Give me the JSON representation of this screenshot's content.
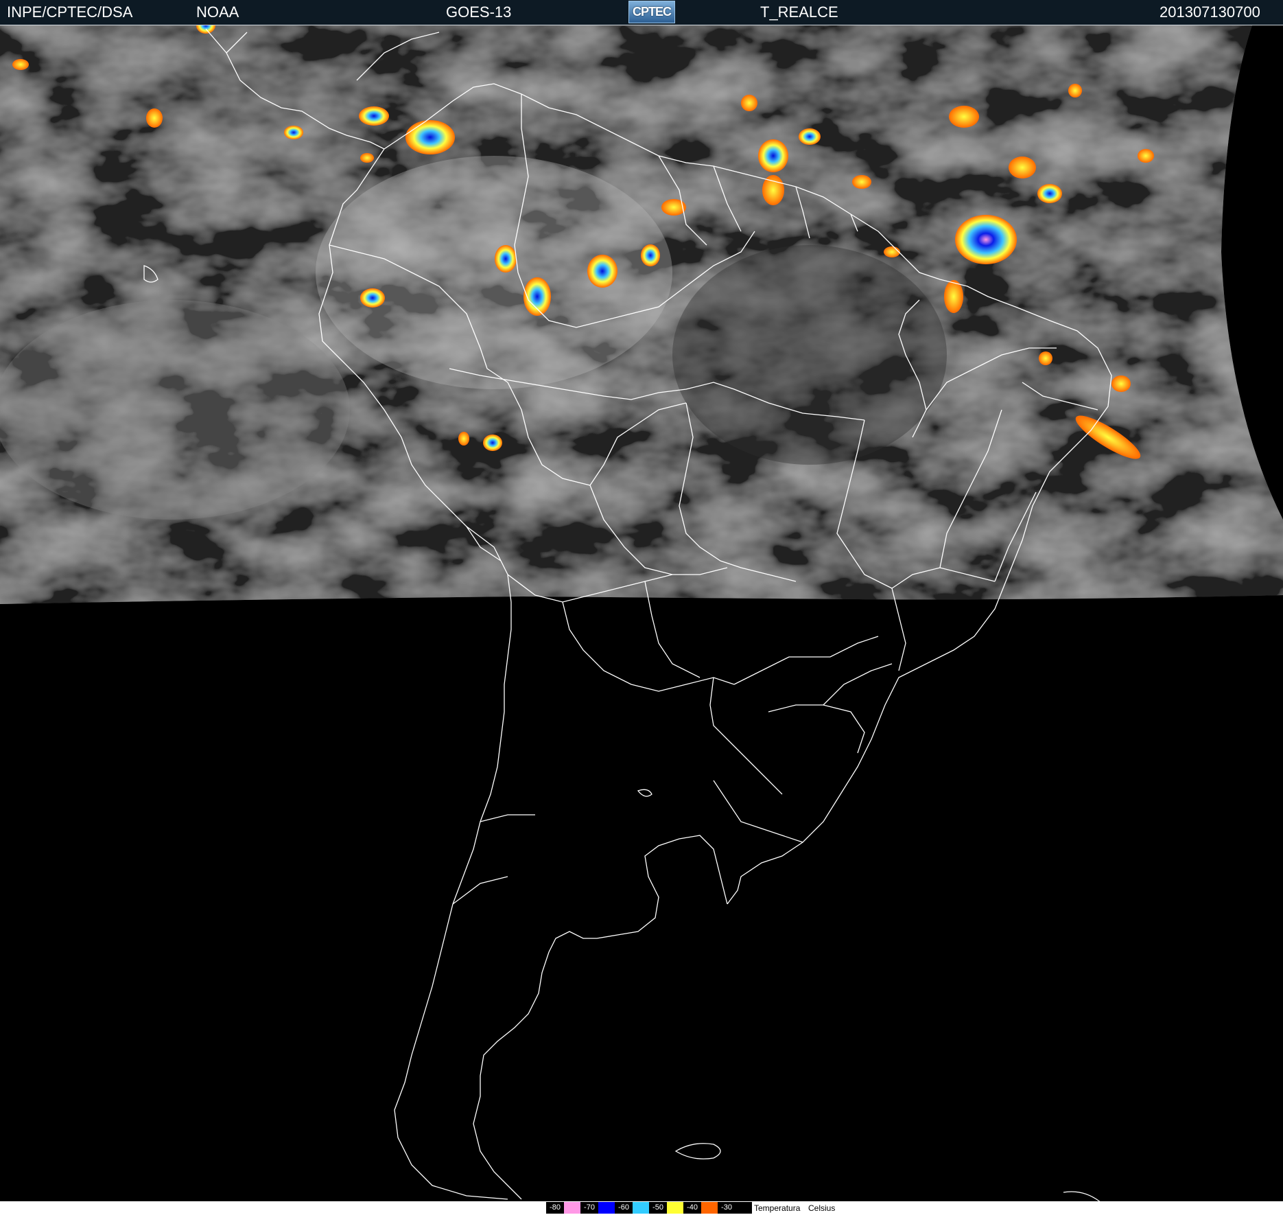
{
  "header": {
    "source": "INPE/CPTEC/DSA",
    "agency": "NOAA",
    "satellite": "GOES-13",
    "logo_text": "CPTEC",
    "product": "T_REALCE",
    "datetime": "201307130700"
  },
  "legend": {
    "items": [
      {
        "label": "-80",
        "color": "#ff99e6"
      },
      {
        "label": "-70",
        "color": "#0000ff"
      },
      {
        "label": "-60",
        "color": "#33ccff"
      },
      {
        "label": "-50",
        "color": "#ffff33"
      },
      {
        "label": "-40",
        "color": "#ff6600"
      },
      {
        "label": "-30",
        "color": "#000000"
      }
    ],
    "title": "Temperatura",
    "unit": "Celsius"
  }
}
